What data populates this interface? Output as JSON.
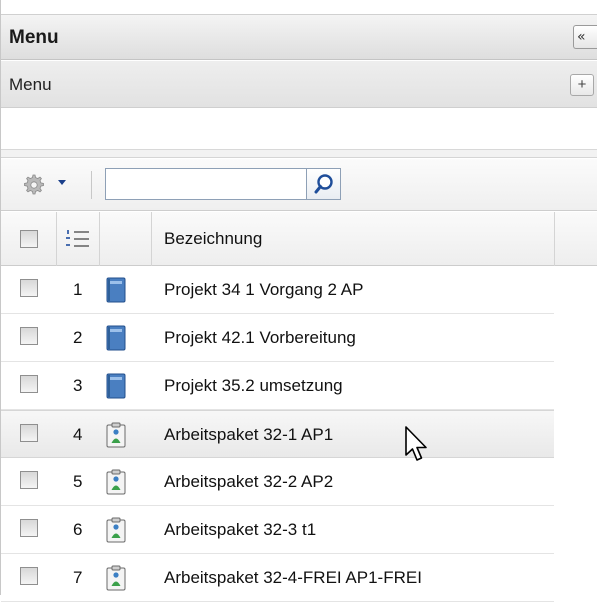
{
  "panel": {
    "title": "Menu",
    "collapse_label": "«"
  },
  "subpanel": {
    "title": "Menu",
    "add_label": "+"
  },
  "toolbar": {
    "gear_icon": "gear-icon",
    "search_value": "",
    "search_placeholder": ""
  },
  "table": {
    "columns": [
      "Bezeichnung"
    ],
    "rows": [
      {
        "num": "1",
        "label": "Projekt 34 1 Vorgang 2 AP",
        "icon": "project-book-icon"
      },
      {
        "num": "2",
        "label": "Projekt 42.1 Vorbereitung",
        "icon": "project-book-icon"
      },
      {
        "num": "3",
        "label": "Projekt 35.2 umsetzung",
        "icon": "project-book-icon"
      },
      {
        "num": "4",
        "label": "Arbeitspaket 32-1 AP1",
        "icon": "work-package-icon"
      },
      {
        "num": "5",
        "label": "Arbeitspaket 32-2 AP2",
        "icon": "work-package-icon"
      },
      {
        "num": "6",
        "label": "Arbeitspaket 32-3 t1",
        "icon": "work-package-icon"
      },
      {
        "num": "7",
        "label": "Arbeitspaket 32-4-FREI AP1-FREI",
        "icon": "work-package-icon"
      }
    ]
  },
  "colors": {
    "project_icon": "#4a7fc1",
    "accent_dark": "#1a3f8a"
  }
}
